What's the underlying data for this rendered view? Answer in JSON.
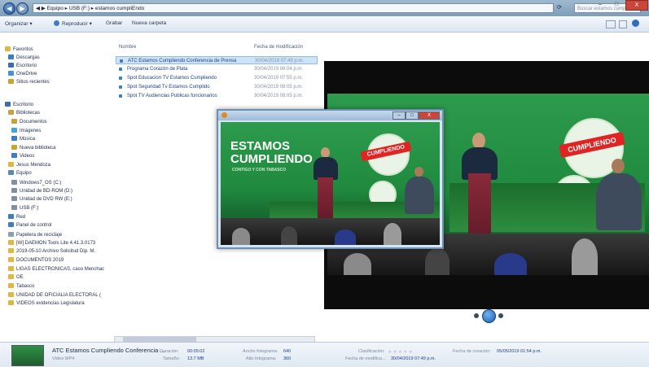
{
  "window": {
    "address_path": "◀ ▶  Equipo ▸ USB (F:) ▸ estamos cumpliEndo",
    "search_placeholder": "Buscar estamos cumpliEndo",
    "min_label": "–",
    "max_label": "□",
    "close_label": "X"
  },
  "toolbar": {
    "organize": "Organizar ▾",
    "play": "Reproducir ▾",
    "burn": "Grabar",
    "new_folder": "Nueva carpeta"
  },
  "nav": {
    "favorites": "Favoritos",
    "items": [
      {
        "label": "Descargas",
        "color": "#3f7dc2"
      },
      {
        "label": "Escritorio",
        "color": "#3b6cb4"
      },
      {
        "label": "OneDrive",
        "color": "#4a90d9"
      },
      {
        "label": "Sitios recientes",
        "color": "#c9a23a"
      },
      {
        "label": "Escritorio",
        "color": "#3b6cb4"
      },
      {
        "label": "Bibliotecas",
        "color": "#c9a23a"
      },
      {
        "label": "Documentos",
        "color": "#c9a23a"
      },
      {
        "label": "Imágenes",
        "color": "#4aa0d8"
      },
      {
        "label": "Música",
        "color": "#3f7dc2"
      },
      {
        "label": "Nueva biblioteca",
        "color": "#c9a23a"
      },
      {
        "label": "Videos",
        "color": "#3f7dc2"
      },
      {
        "label": "Jesus Mendoza",
        "color": "#e3b640"
      },
      {
        "label": "Equipo",
        "color": "#5b87b8"
      },
      {
        "label": "Windows7_OS (C:)",
        "color": "#7f8fa6"
      },
      {
        "label": "Unidad de BD-ROM (D:)",
        "color": "#7f8fa6"
      },
      {
        "label": "Unidad de DVD RW (E:)",
        "color": "#7f8fa6"
      },
      {
        "label": "USB (F:)",
        "color": "#7f8fa6"
      },
      {
        "label": "Red",
        "color": "#3f7dc2"
      },
      {
        "label": "Panel de control",
        "color": "#3f7dc2"
      },
      {
        "label": "Papelera de reciclaje",
        "color": "#8aa0b8"
      },
      {
        "label": "[W] DAEMON Tools Lite 4.41.3.0173",
        "color": "#e3b640"
      },
      {
        "label": "2019-05-10 Archivo Solicitud Dip. M.",
        "color": "#e3b640"
      },
      {
        "label": "DOCUMENTOS 2019",
        "color": "#e3b640"
      },
      {
        "label": "LIGAS ELECTRONICAS, caso Menchac",
        "color": "#e3b640"
      },
      {
        "label": "OE",
        "color": "#e3b640"
      },
      {
        "label": "Tabasco",
        "color": "#e3b640"
      },
      {
        "label": "UNIDAD DE OFICIALIA ELECTORAL (",
        "color": "#e3b640"
      },
      {
        "label": "VIDEOS evidencias Legislatura",
        "color": "#e3b640"
      }
    ]
  },
  "filelist": {
    "col_name": "Nombre",
    "col_date": "Fecha de modificación",
    "files": [
      {
        "name": "ATC Estamos Cumpliendo Conferencia de Prensa",
        "date": "30/04/2019 07:49 p.m."
      },
      {
        "name": "Programa Corazón de Plata",
        "date": "30/04/2019 08:04 p.m."
      },
      {
        "name": "Spot Educacion TV Estamos Cumpliendo",
        "date": "30/04/2019 07:55 p.m."
      },
      {
        "name": "Spot Seguridad Tv Estamos Cumplido",
        "date": "30/04/2019 08:05 p.m."
      },
      {
        "name": "Spot TV Audiencias Publicas funcionarios",
        "date": "30/04/2019 08:05 p.m."
      }
    ]
  },
  "video": {
    "title_line1": "ESTAMOS",
    "title_line2": "CUMPLIENDO",
    "subtitle": "CONTIGO Y CON TABASCO",
    "badge": "CUMPLIENDO"
  },
  "details": {
    "file_title": "ATC Estamos Cumpliendo Conferencia ...",
    "file_type": "Vídeo MP4",
    "duration_label": "Duración:",
    "duration_value": "00:05:02",
    "size_label": "Tamaño:",
    "size_value": "13.7 MB",
    "width_label": "Ancho fotograma:",
    "width_value": "640",
    "height_label": "Alto fotograma:",
    "height_value": "360",
    "rating_label": "Clasificación:",
    "modified_label": "Fecha de modifica...",
    "modified_value": "30/04/2019 07:49 p.m.",
    "created_label": "Fecha de creación:",
    "created_value": "05/05/2019 01:54 p.m."
  }
}
